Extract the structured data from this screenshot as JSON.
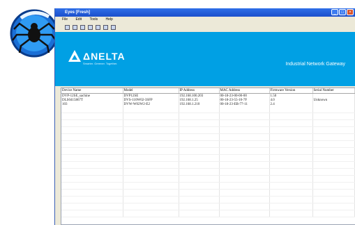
{
  "window": {
    "title": "Eyes [Fresh]",
    "buttons": [
      "_",
      "□",
      "×"
    ]
  },
  "menu": [
    "File",
    "Edit",
    "Tools",
    "Help"
  ],
  "banner": {
    "brand": "ΔNELTA",
    "tagline": "Smarter. Greener. Together.",
    "product": "Industrial Network Gateway",
    "color": "#00a0e4"
  },
  "table": {
    "columns": [
      "Device Name",
      "Model",
      "IP Address",
      "MAC Address",
      "Firmware Version",
      "Serial Number"
    ],
    "rows": [
      [
        "DVP-12SE_sachine",
        "DVP12SE",
        "192.168.100.203",
        "00-18-23-00-00-00",
        "1.50",
        ""
      ],
      [
        "DLS0415867T",
        "DVS-110W02-3SFP",
        "192.168.1.25",
        "00-18-23-55-10-7F",
        "4.0",
        "Unknown"
      ],
      [
        "103",
        "DVW-W02W2-E2",
        "192.168.1.210",
        "00-18-23-EB-77-11",
        "2.4",
        ""
      ]
    ]
  }
}
